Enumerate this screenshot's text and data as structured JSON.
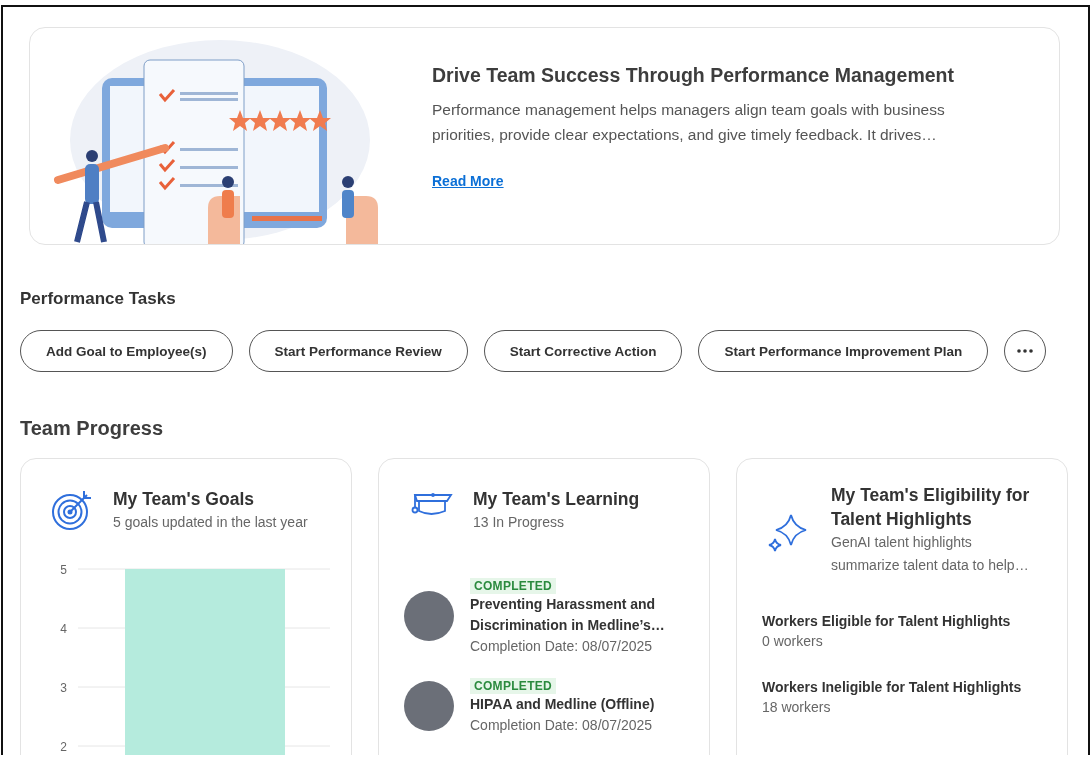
{
  "hero": {
    "title": "Drive Team Success Through Performance Management",
    "body": "Performance management helps managers align team goals with business priorities, provide clear expectations, and give timely feedback. It drives…",
    "link": "Read More"
  },
  "performance_tasks": {
    "heading": "Performance Tasks",
    "buttons": [
      "Add Goal to Employee(s)",
      "Start Performance Review",
      "Start Corrective Action",
      "Start Performance Improvement Plan"
    ]
  },
  "team_progress": {
    "heading": "Team Progress",
    "goals": {
      "title": "My Team's Goals",
      "subtitle": "5 goals updated in the last year",
      "chart_data": {
        "type": "bar",
        "values": [
          5
        ],
        "ylim": [
          0,
          5
        ],
        "yticks": [
          2,
          3,
          4,
          5
        ],
        "grid": true
      }
    },
    "learning": {
      "title": "My Team's Learning",
      "subtitle": "13 In Progress",
      "items": [
        {
          "status": "COMPLETED",
          "title": "Preventing Harassment and Discrimination in Medline’s…",
          "date": "Completion Date: 08/07/2025"
        },
        {
          "status": "COMPLETED",
          "title": "HIPAA and Medline (Offline)",
          "date": "Completion Date: 08/07/2025"
        }
      ]
    },
    "eligibility": {
      "title": "My Team's Eligibility for Talent Highlights",
      "subtitle": "GenAI talent highlights summarize talent data to help…",
      "stats": [
        {
          "label": "Workers Eligible for Talent Highlights",
          "value": "0 workers"
        },
        {
          "label": "Workers Ineligible for Talent Highlights",
          "value": "18 workers"
        }
      ]
    }
  }
}
